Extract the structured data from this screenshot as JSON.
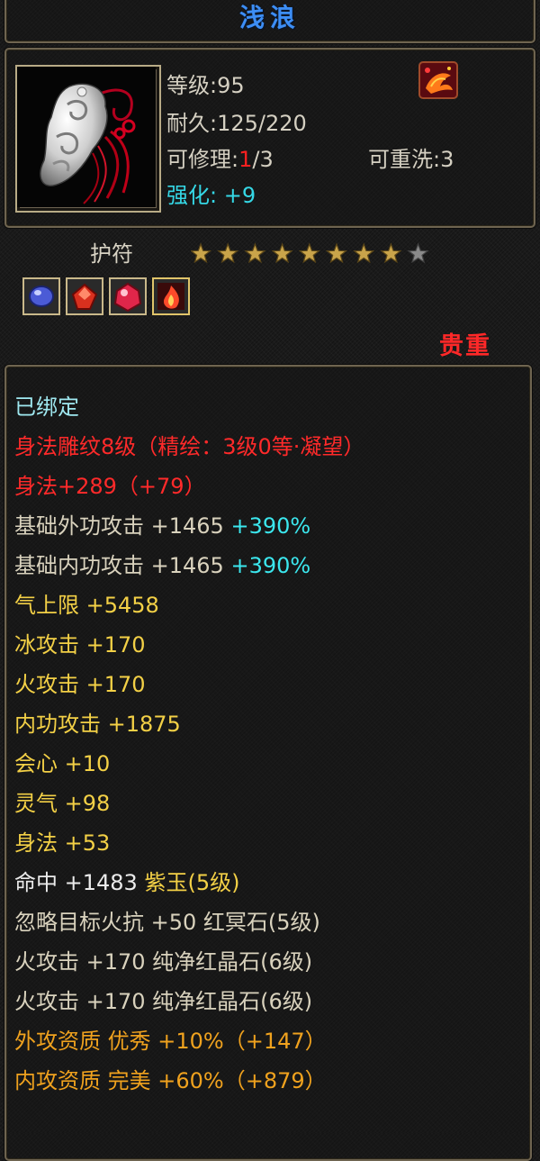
{
  "item": {
    "name": "浅浪",
    "level_text": "等级:95",
    "durability_text": "耐久:125/220",
    "repair_label": "可修理:",
    "repair_used": "1",
    "repair_total": "/3",
    "rewash_text": "可重洗:3",
    "enhance_label": "强化:",
    "enhance_value": "+9",
    "type": "护符",
    "stars_filled": 8,
    "stars_total": 9,
    "rarity": "贵重"
  },
  "icons": {
    "item_icon": "carved-jade-pendant-with-red-knot",
    "badge_icon": "phoenix-badge-icon",
    "gems": [
      "blue-gem-icon",
      "red-gem-icon",
      "red-pink-gem-icon",
      "fire-gem-icon"
    ]
  },
  "colors": {
    "title": "#3d8ef5",
    "bound": "#9fe8f0",
    "carve": "#ff2a2a",
    "base_attr": "#d9d2bd",
    "bonus_attr": "#f3d046",
    "gem_attr": "#ebebeb",
    "aptitude": "#f0a21e",
    "percent": "#3be7ee",
    "star_gold": "#c9a44a",
    "star_empty": "#8a8a8a"
  },
  "attributes": [
    {
      "text": "已绑定",
      "extra": "",
      "color": "c-cyan"
    },
    {
      "text": "身法雕纹8级（精绘：3级0等·凝望）",
      "extra": "",
      "color": "c-red"
    },
    {
      "text": "身法+289（+79）",
      "extra": "",
      "color": "c-red"
    },
    {
      "text": "基础外功攻击 +1465 ",
      "extra": "+390%",
      "color": "c-beige"
    },
    {
      "text": "基础内功攻击 +1465 ",
      "extra": "+390%",
      "color": "c-beige"
    },
    {
      "text": "气上限 +5458",
      "extra": "",
      "color": "c-yellow"
    },
    {
      "text": "冰攻击 +170",
      "extra": "",
      "color": "c-yellow"
    },
    {
      "text": "火攻击 +170",
      "extra": "",
      "color": "c-yellow"
    },
    {
      "text": "内功攻击 +1875",
      "extra": "",
      "color": "c-yellow"
    },
    {
      "text": "会心 +10",
      "extra": "",
      "color": "c-yellow"
    },
    {
      "text": "灵气 +98",
      "extra": "",
      "color": "c-yellow"
    },
    {
      "text": "身法 +53",
      "extra": "",
      "color": "c-yellow"
    },
    {
      "text": "命中 +1483 ",
      "extra": "紫玉(5级)",
      "color": "c-white",
      "extra_color": "c-yellow"
    },
    {
      "text": "忽略目标火抗 +50 红冥石(5级)",
      "extra": "",
      "color": "c-beige"
    },
    {
      "text": "火攻击 +170 纯净红晶石(6级)",
      "extra": "",
      "color": "c-beige"
    },
    {
      "text": "火攻击 +170 纯净红晶石(6级)",
      "extra": "",
      "color": "c-beige"
    },
    {
      "text": "外攻资质 优秀 +10%（+147）",
      "extra": "",
      "color": "c-orange"
    },
    {
      "text": "内攻资质 完美 +60%（+879）",
      "extra": "",
      "color": "c-orange"
    }
  ]
}
